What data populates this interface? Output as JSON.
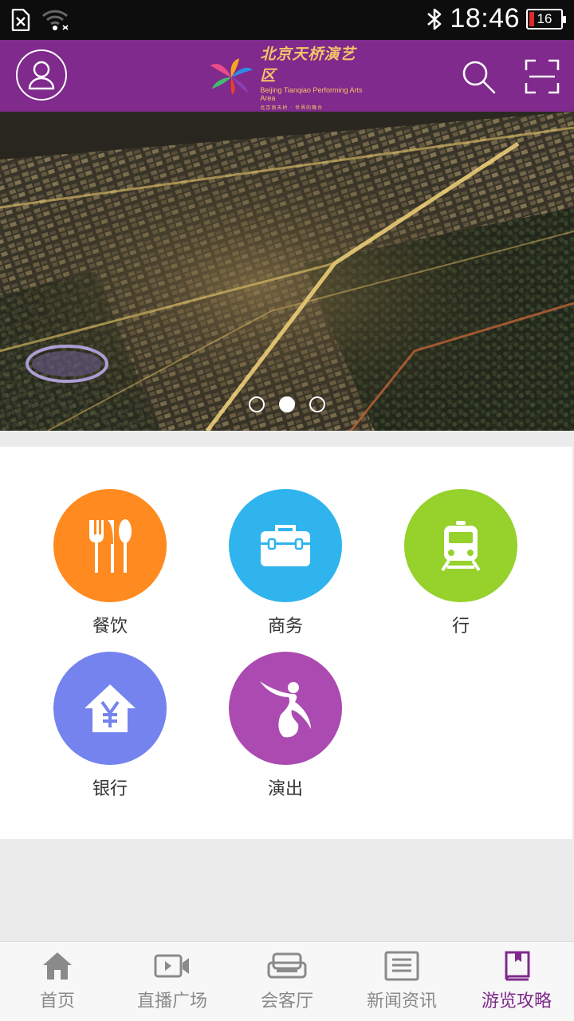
{
  "status_bar": {
    "time": "18:46",
    "battery": "16"
  },
  "header": {
    "logo_cn": "北京天桥演艺区",
    "logo_en": "Beijing Tianqiao Performing Arts Area",
    "logo_tagline": "北京南天桥 · 世界的舞台"
  },
  "banner": {
    "slide_count": 3,
    "active_slide": 2
  },
  "categories": [
    {
      "label": "餐饮",
      "icon": "fork-knife-spoon-icon",
      "color": "#ff8a1f"
    },
    {
      "label": "商务",
      "icon": "briefcase-icon",
      "color": "#2fb4ee"
    },
    {
      "label": "行",
      "icon": "train-icon",
      "color": "#96d12c"
    },
    {
      "label": "银行",
      "icon": "bank-icon",
      "color": "#7583ee"
    },
    {
      "label": "演出",
      "icon": "performer-icon",
      "color": "#ab4ab0"
    }
  ],
  "tabs": [
    {
      "label": "首页",
      "icon": "home-icon"
    },
    {
      "label": "直播广场",
      "icon": "video-icon"
    },
    {
      "label": "会客厅",
      "icon": "sofa-icon"
    },
    {
      "label": "新闻资讯",
      "icon": "news-icon"
    },
    {
      "label": "游览攻略",
      "icon": "guidebook-icon",
      "active": true
    }
  ]
}
